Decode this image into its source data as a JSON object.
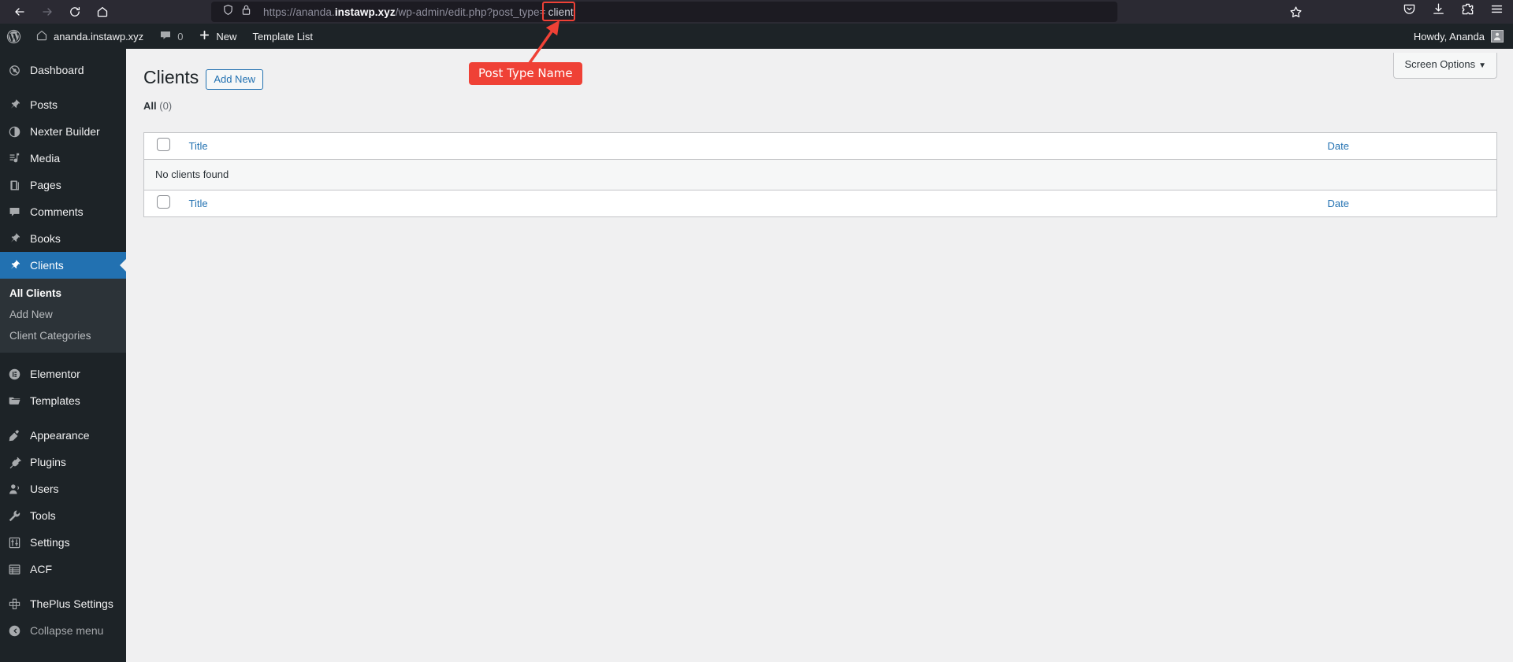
{
  "browser": {
    "nav": [
      {
        "name": "back-button",
        "icon": "arrow-left-icon"
      },
      {
        "name": "forward-button",
        "icon": "arrow-right-icon"
      },
      {
        "name": "reload-button",
        "icon": "reload-icon"
      },
      {
        "name": "home-button",
        "icon": "home-icon"
      }
    ],
    "url": {
      "protocol": "https://",
      "subdomain": "ananda.",
      "domain": "instawp.xyz",
      "path": "/wp-admin/edit.php?post_type=",
      "highlighted_value": "client",
      "full": "https://ananda.instawp.xyz/wp-admin/edit.php?post_type=client"
    },
    "toolbar_icons": [
      {
        "name": "shield-icon"
      },
      {
        "name": "lock-icon"
      },
      {
        "name": "bookmark-star-icon"
      },
      {
        "name": "pocket-icon"
      },
      {
        "name": "downloads-icon"
      },
      {
        "name": "extensions-icon"
      },
      {
        "name": "app-menu-icon"
      }
    ]
  },
  "adminbar": {
    "logo": "wordpress-logo-icon",
    "site_name": "ananda.instawp.xyz",
    "comments_count": "0",
    "new_label": "New",
    "template_list_label": "Template List",
    "howdy": "Howdy, Ananda"
  },
  "sidebar": {
    "items": [
      {
        "label": "Dashboard",
        "icon": "dashboard-icon",
        "current": false,
        "sep_after": true
      },
      {
        "label": "Posts",
        "icon": "pin-icon",
        "current": false
      },
      {
        "label": "Nexter Builder",
        "icon": "nexter-icon",
        "current": false
      },
      {
        "label": "Media",
        "icon": "media-icon",
        "current": false
      },
      {
        "label": "Pages",
        "icon": "pages-icon",
        "current": false
      },
      {
        "label": "Comments",
        "icon": "comments-icon",
        "current": false
      },
      {
        "label": "Books",
        "icon": "pin-icon",
        "current": false
      },
      {
        "label": "Clients",
        "icon": "pin-icon",
        "current": true
      }
    ],
    "submenu": [
      {
        "label": "All Clients",
        "current": true
      },
      {
        "label": "Add New",
        "current": false
      },
      {
        "label": "Client Categories",
        "current": false
      }
    ],
    "items2": [
      {
        "label": "Elementor",
        "icon": "elementor-icon"
      },
      {
        "label": "Templates",
        "icon": "folder-icon",
        "sep_after": true
      },
      {
        "label": "Appearance",
        "icon": "appearance-icon"
      },
      {
        "label": "Plugins",
        "icon": "plugins-icon"
      },
      {
        "label": "Users",
        "icon": "users-icon"
      },
      {
        "label": "Tools",
        "icon": "tools-icon"
      },
      {
        "label": "Settings",
        "icon": "settings-icon"
      },
      {
        "label": "ACF",
        "icon": "acf-icon",
        "sep_after": true
      },
      {
        "label": "ThePlus Settings",
        "icon": "theplus-icon"
      }
    ],
    "collapse_label": "Collapse menu",
    "collapse_icon": "collapse-arrow-icon",
    "highlight_color": "#2271b1"
  },
  "screen_meta": {
    "screen_options_label": "Screen Options"
  },
  "main": {
    "page_title": "Clients",
    "add_new_label": "Add New",
    "filters": {
      "all_label": "All",
      "all_count": "(0)"
    },
    "table": {
      "columns": {
        "title": "Title",
        "date": "Date"
      },
      "rows": [],
      "empty_message": "No clients found"
    }
  },
  "annotation": {
    "label": "Post Type Name",
    "color": "#ef4136",
    "target": "client"
  }
}
